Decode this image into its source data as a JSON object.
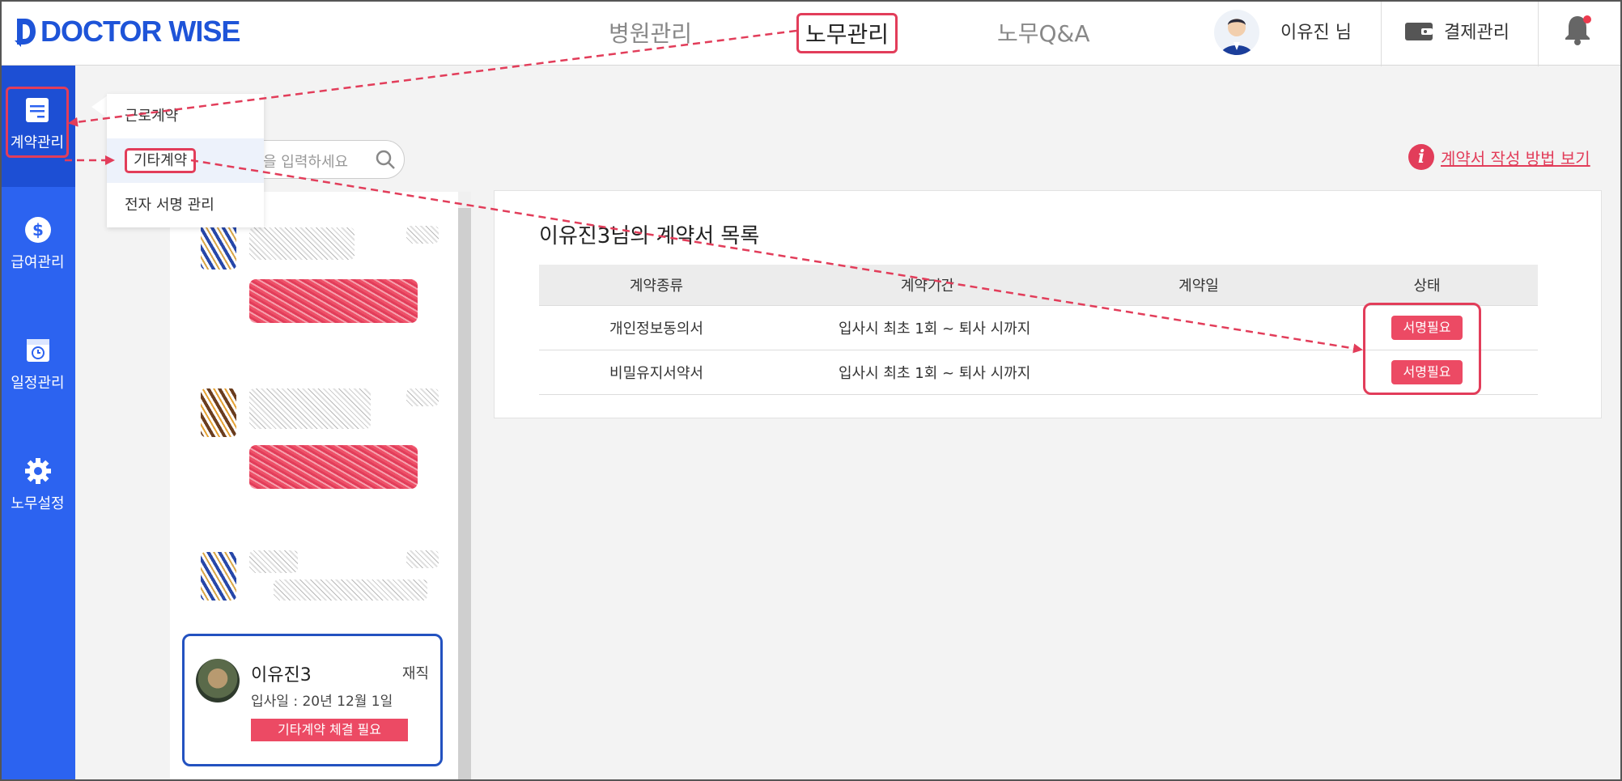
{
  "header": {
    "logo_text": "DOCTOR WISE",
    "nav": [
      "병원관리",
      "노무관리",
      "노무Q&A"
    ],
    "active_nav": "노무관리",
    "user_name": "이유진 님",
    "payment_label": "결제관리"
  },
  "sidebar": {
    "items": [
      {
        "label": "계약관리",
        "icon": "document-icon"
      },
      {
        "label": "급여관리",
        "icon": "dollar-icon"
      },
      {
        "label": "일정관리",
        "icon": "calendar-icon"
      },
      {
        "label": "노무설정",
        "icon": "gear-icon"
      }
    ]
  },
  "dropdown": {
    "items": [
      "근로계약",
      "기타계약",
      "전자 서명 관리"
    ]
  },
  "search": {
    "placeholder": "을 입력하세요"
  },
  "employee_card": {
    "name": "이유진3",
    "status": "재직",
    "hire_date": "입사일 : 20년 12월 1일",
    "tag": "기타계약 체결 필요"
  },
  "guide_link": "계약서 작성 방법 보기",
  "contract_list": {
    "title": "이유진3님의 계약서 목록",
    "columns": [
      "계약종류",
      "계약기간",
      "계약일",
      "상태"
    ],
    "rows": [
      {
        "type": "개인정보동의서",
        "period": "입사시 최초 1회 ~ 퇴사 시까지",
        "date": "",
        "status": "서명필요"
      },
      {
        "type": "비밀유지서약서",
        "period": "입사시 최초 1회 ~ 퇴사 시까지",
        "date": "",
        "status": "서명필요"
      }
    ]
  },
  "colors": {
    "brand_blue": "#2c63f0",
    "annotation_red": "#e23d5a",
    "sign_button": "#ec4a64"
  }
}
